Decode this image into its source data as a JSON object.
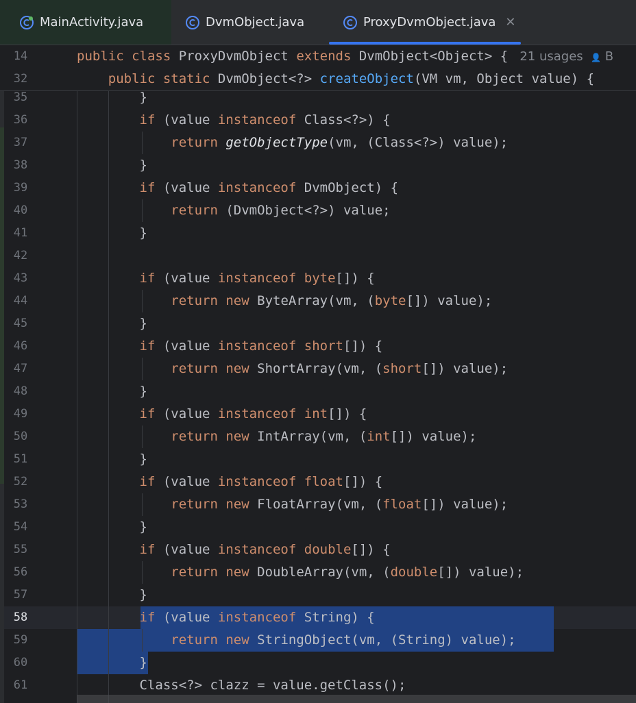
{
  "tabs": [
    {
      "label": "MainActivity.java",
      "active": false
    },
    {
      "label": "DvmObject.java",
      "active": false
    },
    {
      "label": "ProxyDvmObject.java",
      "active": true,
      "closable": true
    }
  ],
  "tab_icon": "java-class-icon",
  "close_icon": "close-icon",
  "colors": {
    "accent": "#3574f0",
    "keyword": "#cf8e6d",
    "method": "#56a8f5",
    "selection": "#214283"
  },
  "sticky_lines": [
    {
      "num": "14",
      "tokens": [
        [
          "kw",
          "public class "
        ],
        [
          "",
          "ProxyDvmObject "
        ],
        [
          "kw",
          "extends "
        ],
        [
          "",
          "DvmObject<Object> { "
        ]
      ],
      "hint": "21 usages",
      "author_icon": "person-icon",
      "author": "B"
    },
    {
      "num": "32",
      "tokens": [
        [
          "",
          "    "
        ],
        [
          "kw",
          "public static "
        ],
        [
          "",
          "DvmObject<?> "
        ],
        [
          "mth",
          "createObject"
        ],
        [
          "",
          "(VM vm, Object value) {"
        ]
      ]
    }
  ],
  "lines": [
    {
      "num": "35",
      "tokens": [
        [
          "",
          "        }"
        ]
      ]
    },
    {
      "num": "36",
      "tokens": [
        [
          "",
          "        "
        ],
        [
          "kw",
          "if "
        ],
        [
          "",
          "(value "
        ],
        [
          "kw",
          "instanceof "
        ],
        [
          "",
          "Class<?>) {"
        ]
      ]
    },
    {
      "num": "37",
      "tokens": [
        [
          "",
          "            "
        ],
        [
          "kw",
          "return "
        ],
        [
          "it",
          "getObjectType"
        ],
        [
          "",
          "(vm, (Class<?>) value);"
        ]
      ]
    },
    {
      "num": "38",
      "tokens": [
        [
          "",
          "        }"
        ]
      ]
    },
    {
      "num": "39",
      "tokens": [
        [
          "",
          "        "
        ],
        [
          "kw",
          "if "
        ],
        [
          "",
          "(value "
        ],
        [
          "kw",
          "instanceof "
        ],
        [
          "",
          "DvmObject) {"
        ]
      ]
    },
    {
      "num": "40",
      "tokens": [
        [
          "",
          "            "
        ],
        [
          "kw",
          "return "
        ],
        [
          "",
          "(DvmObject<?>) value;"
        ]
      ]
    },
    {
      "num": "41",
      "tokens": [
        [
          "",
          "        }"
        ]
      ]
    },
    {
      "num": "42",
      "tokens": [
        [
          "",
          ""
        ]
      ]
    },
    {
      "num": "43",
      "tokens": [
        [
          "",
          "        "
        ],
        [
          "kw",
          "if "
        ],
        [
          "",
          "(value "
        ],
        [
          "kw",
          "instanceof "
        ],
        [
          "kw",
          "byte"
        ],
        [
          "",
          "[]) {"
        ]
      ]
    },
    {
      "num": "44",
      "tokens": [
        [
          "",
          "            "
        ],
        [
          "kw",
          "return new "
        ],
        [
          "",
          "ByteArray(vm, ("
        ],
        [
          "kw",
          "byte"
        ],
        [
          "",
          "[]) value);"
        ]
      ]
    },
    {
      "num": "45",
      "tokens": [
        [
          "",
          "        }"
        ]
      ]
    },
    {
      "num": "46",
      "tokens": [
        [
          "",
          "        "
        ],
        [
          "kw",
          "if "
        ],
        [
          "",
          "(value "
        ],
        [
          "kw",
          "instanceof "
        ],
        [
          "kw",
          "short"
        ],
        [
          "",
          "[]) {"
        ]
      ]
    },
    {
      "num": "47",
      "tokens": [
        [
          "",
          "            "
        ],
        [
          "kw",
          "return new "
        ],
        [
          "",
          "ShortArray(vm, ("
        ],
        [
          "kw",
          "short"
        ],
        [
          "",
          "[]) value);"
        ]
      ]
    },
    {
      "num": "48",
      "tokens": [
        [
          "",
          "        }"
        ]
      ]
    },
    {
      "num": "49",
      "tokens": [
        [
          "",
          "        "
        ],
        [
          "kw",
          "if "
        ],
        [
          "",
          "(value "
        ],
        [
          "kw",
          "instanceof "
        ],
        [
          "kw",
          "int"
        ],
        [
          "",
          "[]) {"
        ]
      ]
    },
    {
      "num": "50",
      "tokens": [
        [
          "",
          "            "
        ],
        [
          "kw",
          "return new "
        ],
        [
          "",
          "IntArray(vm, ("
        ],
        [
          "kw",
          "int"
        ],
        [
          "",
          "[]) value);"
        ]
      ]
    },
    {
      "num": "51",
      "tokens": [
        [
          "",
          "        }"
        ]
      ]
    },
    {
      "num": "52",
      "tokens": [
        [
          "",
          "        "
        ],
        [
          "kw",
          "if "
        ],
        [
          "",
          "(value "
        ],
        [
          "kw",
          "instanceof "
        ],
        [
          "kw",
          "float"
        ],
        [
          "",
          "[]) {"
        ]
      ]
    },
    {
      "num": "53",
      "tokens": [
        [
          "",
          "            "
        ],
        [
          "kw",
          "return new "
        ],
        [
          "",
          "FloatArray(vm, ("
        ],
        [
          "kw",
          "float"
        ],
        [
          "",
          "[]) value);"
        ]
      ]
    },
    {
      "num": "54",
      "tokens": [
        [
          "",
          "        }"
        ]
      ]
    },
    {
      "num": "55",
      "tokens": [
        [
          "",
          "        "
        ],
        [
          "kw",
          "if "
        ],
        [
          "",
          "(value "
        ],
        [
          "kw",
          "instanceof "
        ],
        [
          "kw",
          "double"
        ],
        [
          "",
          "[]) {"
        ]
      ]
    },
    {
      "num": "56",
      "tokens": [
        [
          "",
          "            "
        ],
        [
          "kw",
          "return new "
        ],
        [
          "",
          "DoubleArray(vm, ("
        ],
        [
          "kw",
          "double"
        ],
        [
          "",
          "[]) value);"
        ]
      ]
    },
    {
      "num": "57",
      "tokens": [
        [
          "",
          "        }"
        ]
      ]
    },
    {
      "num": "58",
      "tokens": [
        [
          "",
          "        "
        ],
        [
          "kw",
          "if "
        ],
        [
          "",
          "(value "
        ],
        [
          "kw",
          "instanceof "
        ],
        [
          "",
          "String) {"
        ]
      ],
      "current": true
    },
    {
      "num": "59",
      "tokens": [
        [
          "",
          "            "
        ],
        [
          "kw",
          "return new "
        ],
        [
          "",
          "StringObject(vm, (String) value);"
        ]
      ]
    },
    {
      "num": "60",
      "tokens": [
        [
          "",
          "        }"
        ]
      ]
    },
    {
      "num": "61",
      "tokens": [
        [
          "",
          "        Class<?> clazz = value.getClass();"
        ]
      ]
    }
  ]
}
